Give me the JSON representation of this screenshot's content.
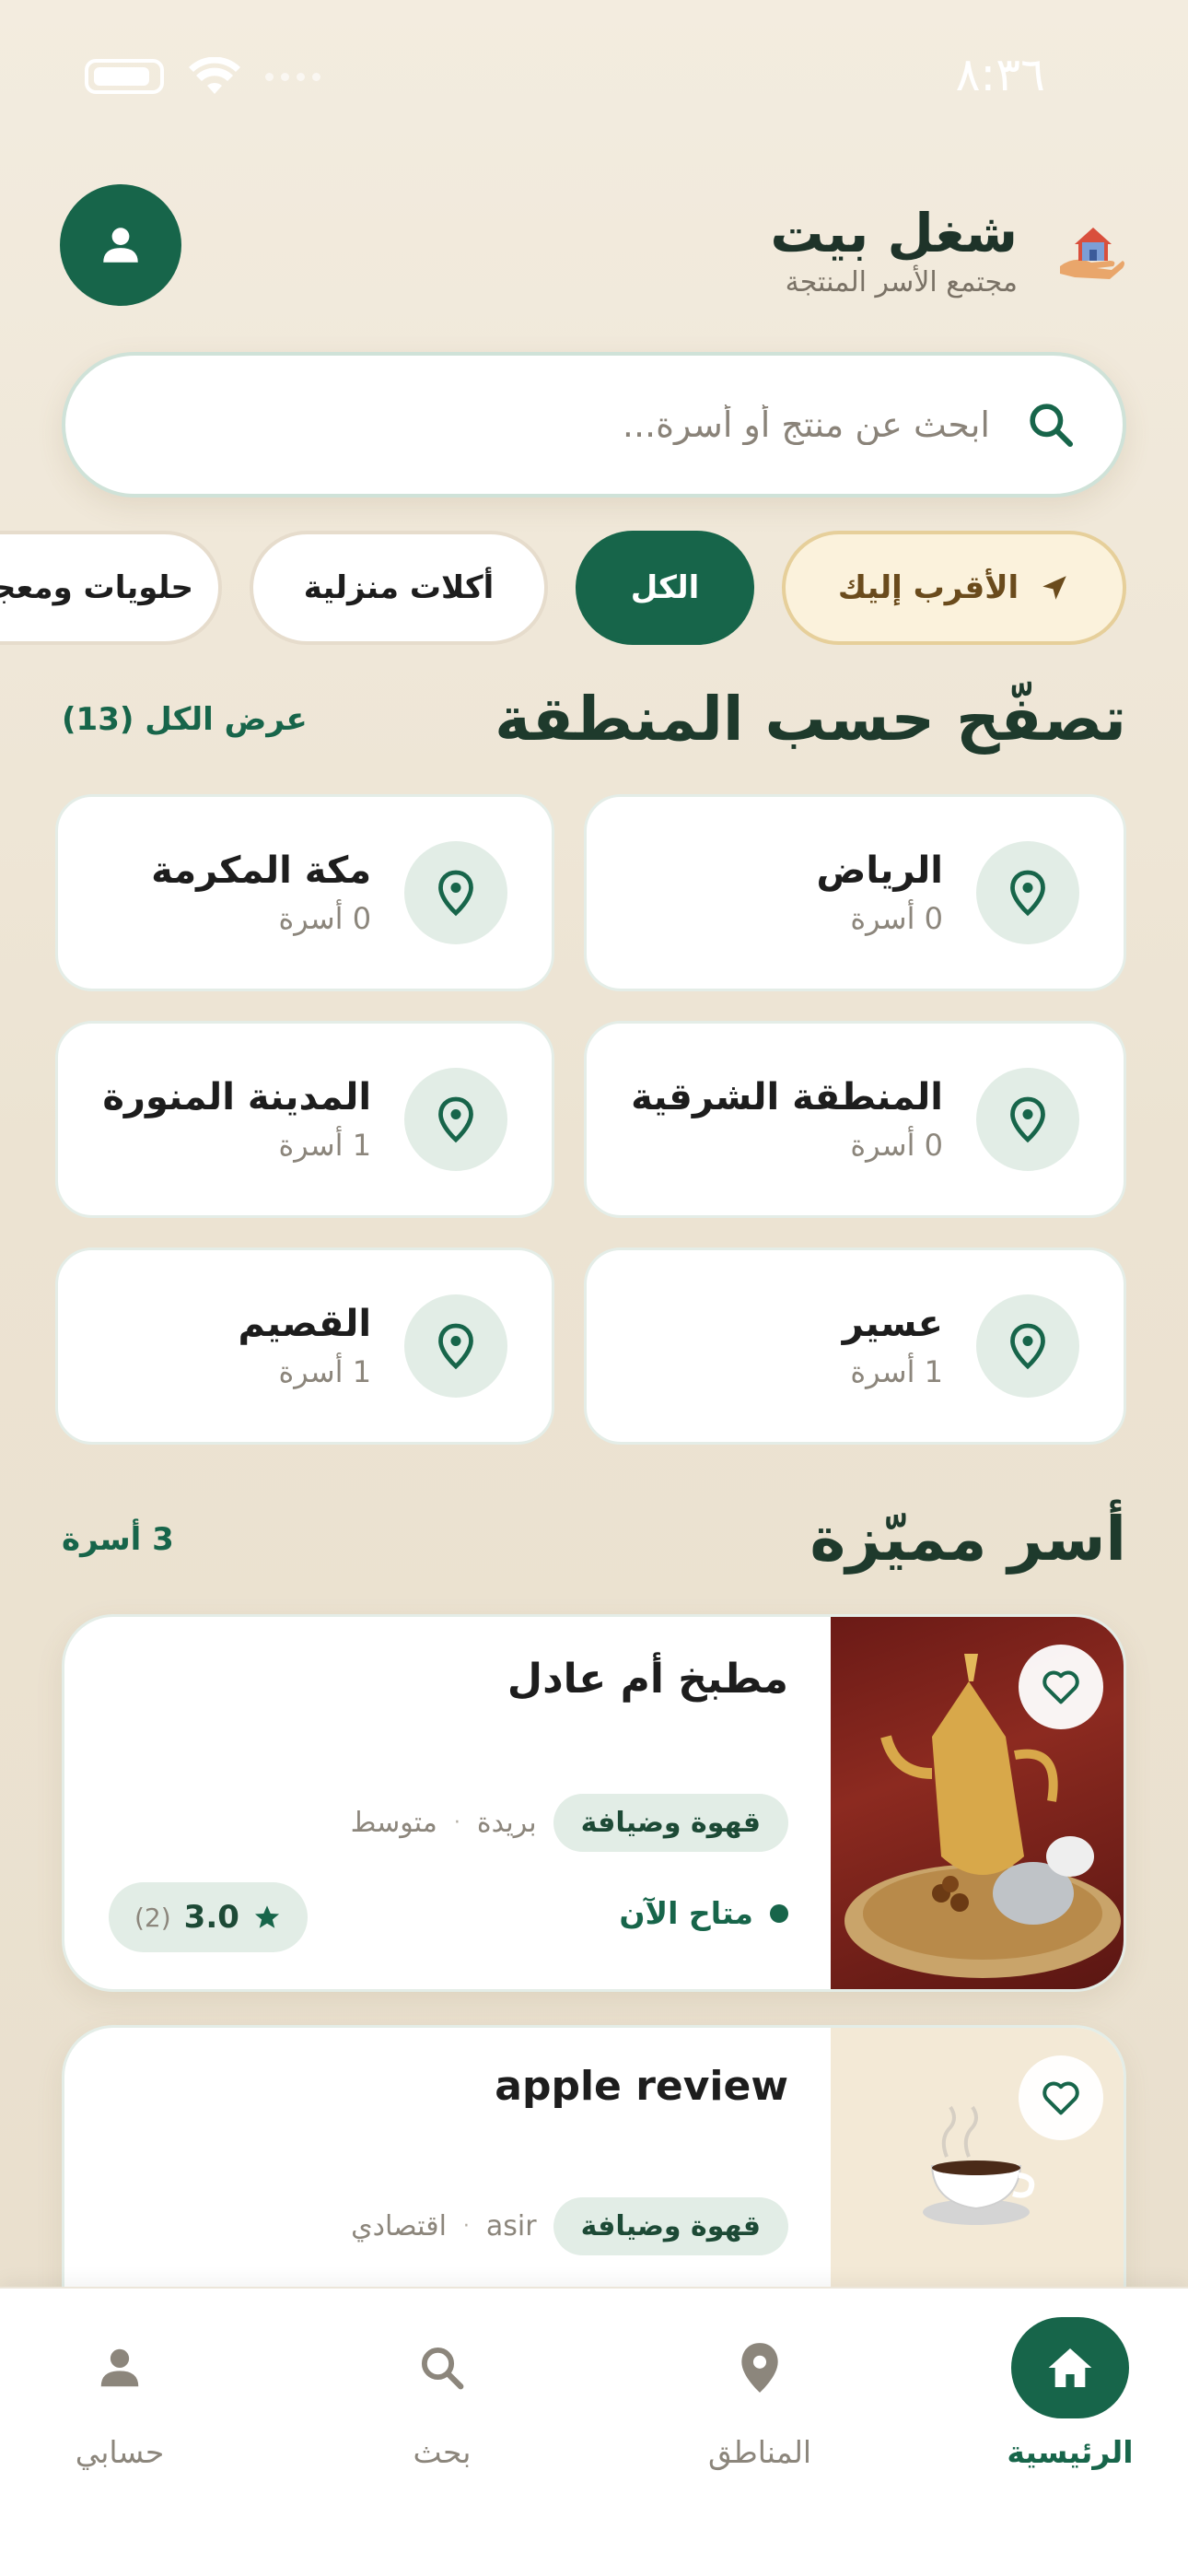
{
  "status_bar": {
    "time": "٨:٣٦"
  },
  "header": {
    "title": "شغل بيت",
    "subtitle": "مجتمع الأسر المنتجة",
    "logo_icon": "house-hand-icon",
    "profile_icon": "user-icon"
  },
  "search": {
    "placeholder": "ابحث عن منتج أو أسرة..."
  },
  "filters": [
    {
      "label": "الأقرب إليك",
      "icon": "navigation-arrow-icon"
    },
    {
      "label": "الكل",
      "active": true
    },
    {
      "label": "أكلات منزلية"
    },
    {
      "label": "حلويات ومعجنات"
    }
  ],
  "regions_section": {
    "title": "تصفّح حسب المنطقة",
    "view_all": "عرض الكل (13)",
    "items": [
      {
        "name": "الرياض",
        "count": "0 أسرة"
      },
      {
        "name": "مكة المكرمة",
        "count": "0 أسرة"
      },
      {
        "name": "المنطقة الشرقية",
        "count": "0 أسرة"
      },
      {
        "name": "المدينة المنورة",
        "count": "1 أسرة"
      },
      {
        "name": "عسير",
        "count": "1 أسرة"
      },
      {
        "name": "القصيم",
        "count": "1 أسرة"
      }
    ]
  },
  "families_section": {
    "title": "أسر مميّزة",
    "count": "3 أسرة",
    "items": [
      {
        "name": "مطبخ أم عادل",
        "tag": "قهوة وضيافة",
        "city": "بريدة",
        "price": "متوسط",
        "status": "متاح الآن",
        "rating": "3.0",
        "reviews": "(2)"
      },
      {
        "name": "apple review",
        "tag": "قهوة وضيافة",
        "city": "asir",
        "price": "اقتصادي"
      }
    ]
  },
  "tabbar": {
    "home": "الرئيسية",
    "regions": "المناطق",
    "search": "بحث",
    "account": "حسابي"
  },
  "colors": {
    "primary": "#17654a",
    "background": "#efe7d8"
  }
}
